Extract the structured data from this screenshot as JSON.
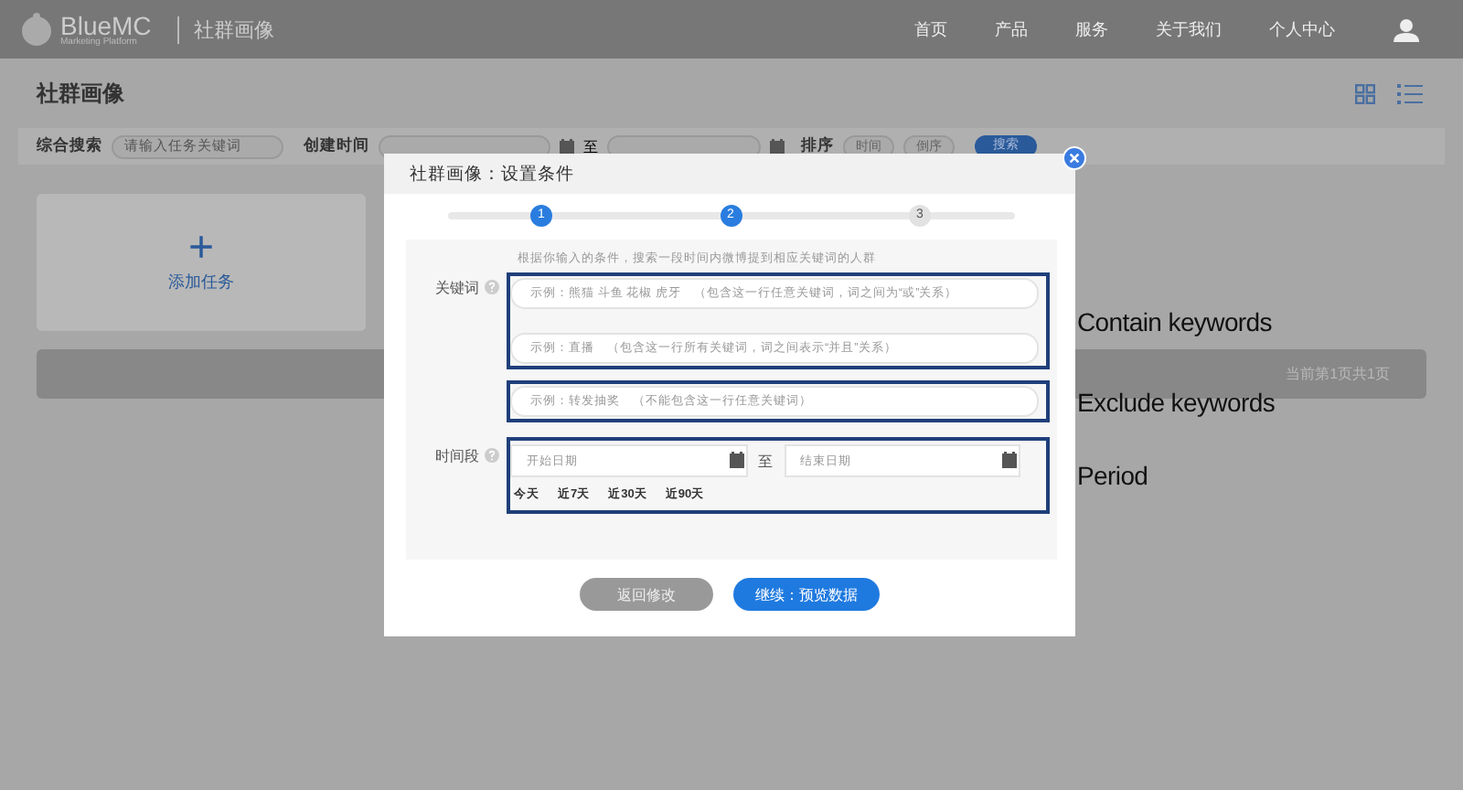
{
  "nav": {
    "logo": "BlueMC",
    "logo_sub": "Marketing Platform",
    "section": "社群画像",
    "links": [
      "首页",
      "产品",
      "服务",
      "关于我们",
      "个人中心"
    ]
  },
  "page": {
    "title": "社群画像"
  },
  "filters": {
    "search_label": "综合搜索",
    "search_placeholder": "请输入任务关键词",
    "created_label": "创建时间",
    "range_sep": "至",
    "sort_label": "排序",
    "sort_options": [
      "时间",
      "倒序"
    ],
    "search_button": "搜索"
  },
  "add_task": {
    "icon": "+",
    "label": "添加任务"
  },
  "pagination": "当前第1页共1页",
  "dialog": {
    "title": "社群画像：设置条件",
    "steps": [
      {
        "label": "1",
        "active": true
      },
      {
        "label": "2",
        "active": true
      },
      {
        "label": "3",
        "active": false
      }
    ],
    "hint": "根据你输入的条件，搜索一段时间内微博提到相应关键词的人群",
    "keyword_label": "关键词",
    "include_fields": [
      {
        "placeholder": "示例：熊猫 斗鱼 花椒 虎牙　（包含这一行任意关键词，词之间为“或”关系）"
      },
      {
        "placeholder": "示例：直播　（包含这一行所有关键词，词之间表示“并且”关系）"
      }
    ],
    "exclude_field": {
      "placeholder": "示例：转发抽奖　（不能包含这一行任意关键词）"
    },
    "period_label": "时间段",
    "start_placeholder": "开始日期",
    "range_sep": "至",
    "end_placeholder": "结束日期",
    "quick_ranges": [
      "今天",
      "近7天",
      "近30天",
      "近90天"
    ],
    "buttons": [
      {
        "label": "返回修改",
        "kind": "secondary"
      },
      {
        "label": "继续：预览数据",
        "kind": "primary"
      }
    ]
  },
  "annotations": [
    {
      "label": "Contain keywords"
    },
    {
      "label": "Exclude keywords"
    },
    {
      "label": "Period"
    }
  ]
}
